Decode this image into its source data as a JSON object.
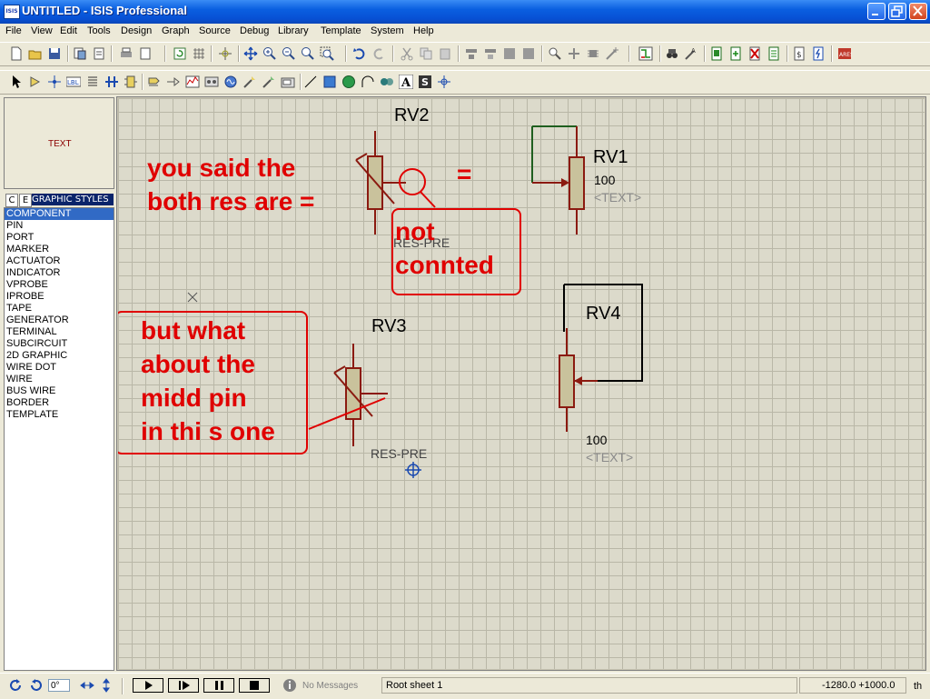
{
  "window": {
    "app_icon": "ISIS",
    "title": "UNTITLED - ISIS Professional"
  },
  "menu": [
    "File",
    "View",
    "Edit",
    "Tools",
    "Design",
    "Graph",
    "Source",
    "Debug",
    "Library",
    "Template",
    "System",
    "Help"
  ],
  "preview": {
    "text": "TEXT"
  },
  "mode": {
    "c": "C",
    "e": "E",
    "label": "GRAPHIC STYLES"
  },
  "object_list": {
    "selected": "COMPONENT",
    "items": [
      "COMPONENT",
      "PIN",
      "PORT",
      "MARKER",
      "ACTUATOR",
      "INDICATOR",
      "VPROBE",
      "IPROBE",
      "TAPE",
      "GENERATOR",
      "TERMINAL",
      "SUBCIRCUIT",
      "2D GRAPHIC",
      "WIRE DOT",
      "WIRE",
      "BUS WIRE",
      "BORDER",
      "TEMPLATE"
    ]
  },
  "schematic": {
    "rv2": {
      "ref": "RV2",
      "type": "RES-PRE"
    },
    "rv1": {
      "ref": "RV1",
      "value": "100",
      "text": "<TEXT>"
    },
    "rv3": {
      "ref": "RV3",
      "type": "RES-PRE"
    },
    "rv4": {
      "ref": "RV4",
      "value": "100",
      "text": "<TEXT>"
    },
    "equals": "=",
    "annotations": {
      "note1_line1": "you said  the",
      "note1_line2": "both res are =",
      "note2_line1": "not",
      "note2_line2": "connted",
      "note3_line1": "but what",
      "note3_line2": "about the",
      "note3_line3": "midd pin",
      "note3_line4": "in thi s one"
    },
    "colors": {
      "annotation": "#e00000",
      "component": "#8b1a10",
      "wire": "#1f5f1f",
      "body": "#c9c29c"
    }
  },
  "status": {
    "rotation": "0°",
    "messages": "No Messages",
    "sheet": "Root sheet 1",
    "coordinates": "-1280.0  +1000.0",
    "units": "th"
  }
}
